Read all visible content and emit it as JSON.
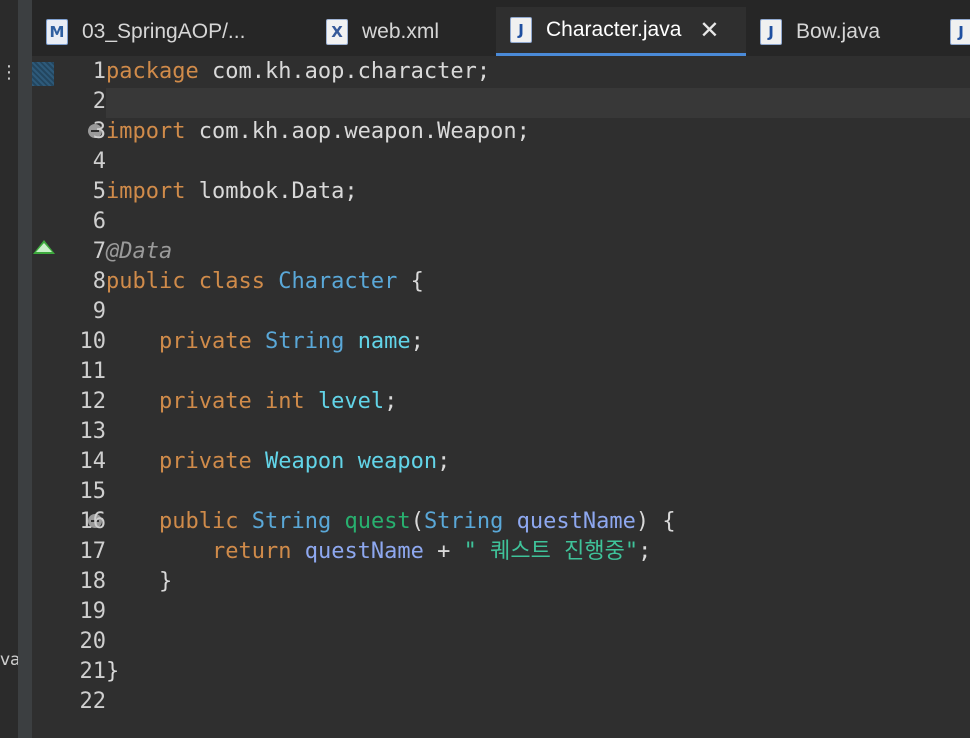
{
  "left_panel": {
    "marker1": "⋮",
    "marker2": "va"
  },
  "tabs": [
    {
      "icon": "maven-icon",
      "glyph": "M",
      "label": "03_SpringAOP/..."
    },
    {
      "icon": "xml-file-icon",
      "glyph": "X",
      "label": "web.xml"
    },
    {
      "icon": "java-file-icon",
      "glyph": "J",
      "label": "Character.java",
      "active": true
    },
    {
      "icon": "java-file-icon",
      "glyph": "J",
      "label": "Bow.java"
    },
    {
      "icon": "java-file-icon",
      "glyph": "J",
      "label": ""
    }
  ],
  "editor": {
    "line_numbers": [
      "1",
      "2",
      "3",
      "4",
      "5",
      "6",
      "7",
      "8",
      "9",
      "10",
      "11",
      "12",
      "13",
      "14",
      "15",
      "16",
      "17",
      "18",
      "19",
      "20",
      "21",
      "22"
    ],
    "lines": {
      "l1_kw": "package",
      "l1_rest": " com.kh.aop.character;",
      "l3_kw": "import",
      "l3_rest": " com.kh.aop.weapon.Weapon;",
      "l5_kw": "import",
      "l5_rest": " lombok.Data;",
      "l7_ann": "@Data",
      "l8_kw": "public class",
      "l8_type": "Character",
      "l8_rest": " {",
      "l10_kw": "private",
      "l10_type": "String",
      "l10_field": "name",
      "l10_end": ";",
      "l12_kw": "private int",
      "l12_field": "level",
      "l12_end": ";",
      "l14_kw": "private",
      "l14_field_type": "Weapon",
      "l14_field": "weapon",
      "l14_end": ";",
      "l16_kw": "public",
      "l16_type": "String",
      "l16_fn": "quest",
      "l16_open": "(",
      "l16_ptype": "String",
      "l16_param": "questName",
      "l16_close": ") {",
      "l17_kw": "return",
      "l17_param": "questName",
      "l17_op": " + ",
      "l17_str": "\" 퀘스트 진행중\"",
      "l17_end": ";",
      "l18_brace": "}",
      "l21_brace": "}"
    }
  }
}
